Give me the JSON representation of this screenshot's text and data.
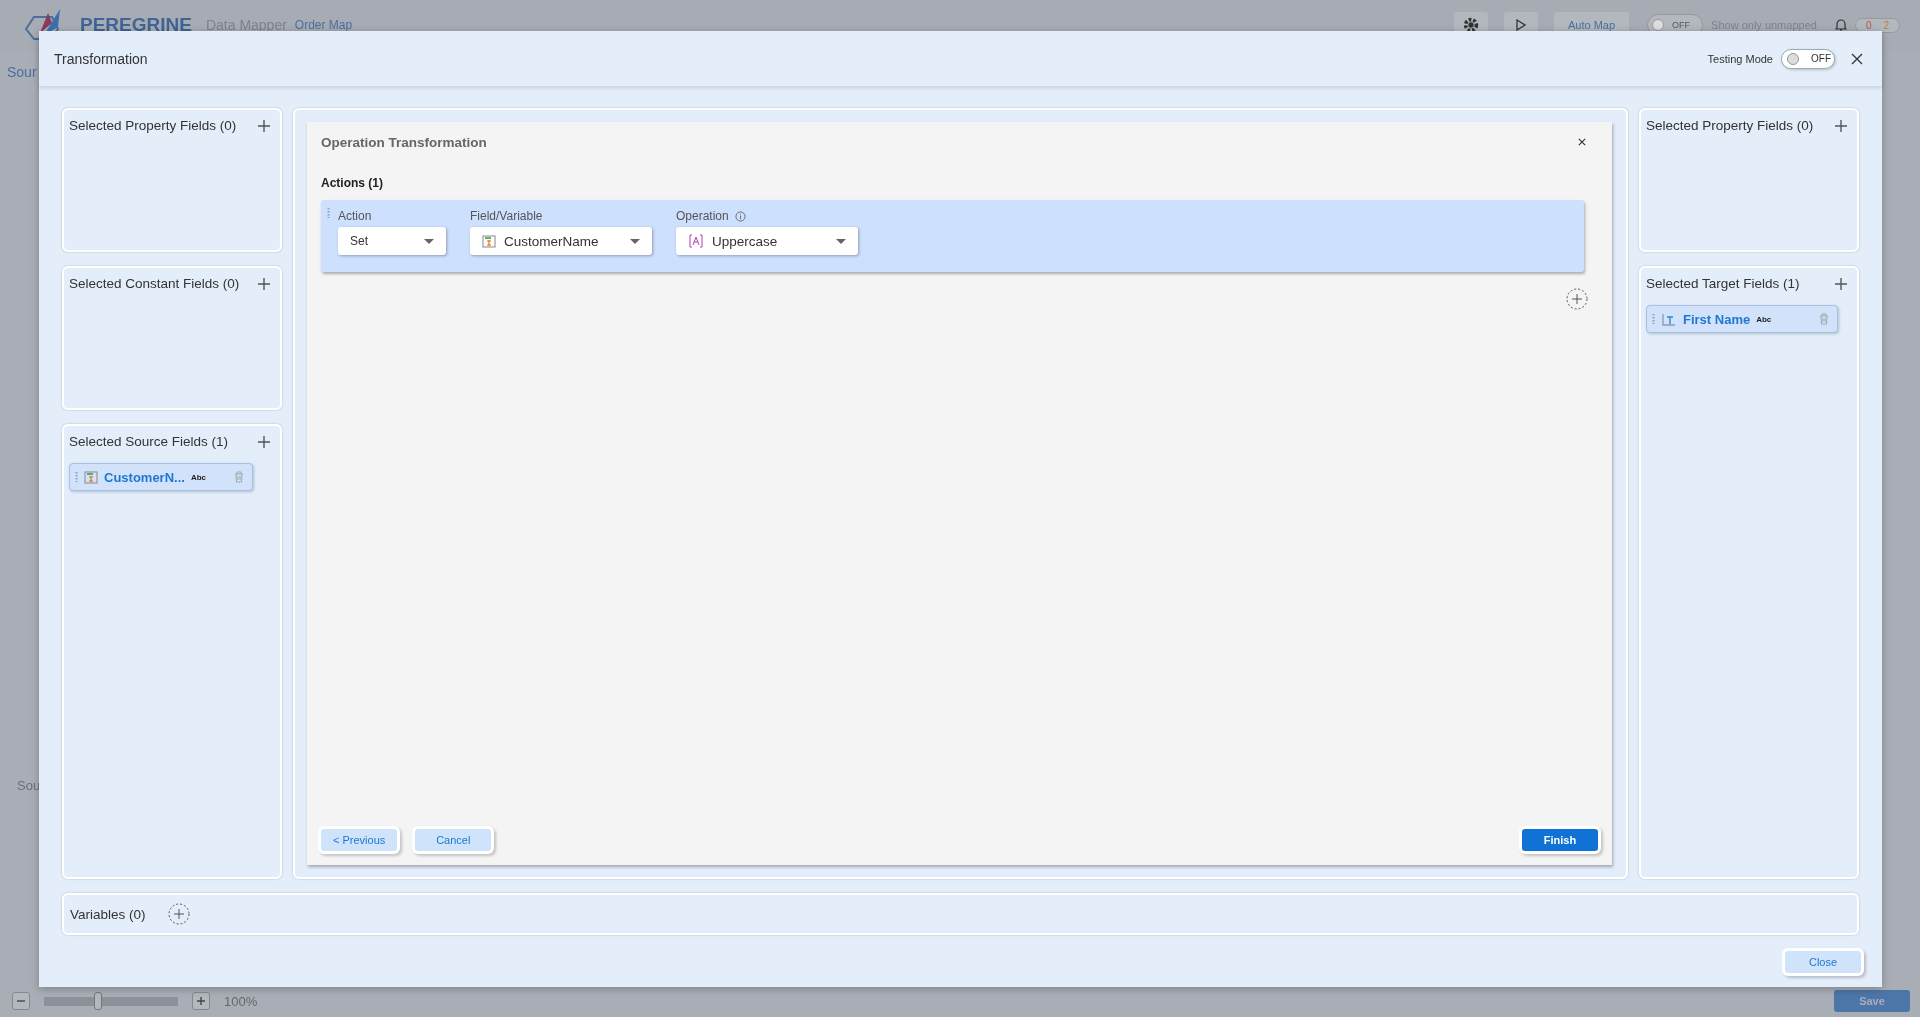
{
  "app": {
    "brand": "PEREGRINE",
    "subtitle": "Data Mapper",
    "map_name": "Order Map",
    "auto_map": "Auto Map",
    "unmapped_toggle": {
      "on": false,
      "text": "OFF",
      "label": "Show only unmapped"
    },
    "error_count": "0",
    "warning_count": "2",
    "source_tab": "Sour",
    "source_section": "Sou",
    "zoom": {
      "level": 0.4,
      "text": "100%"
    },
    "save": "Save"
  },
  "dialog": {
    "title": "Transformation",
    "testing_mode": {
      "label": "Testing Mode",
      "on": false,
      "text": "OFF"
    },
    "left_panels": [
      {
        "title": "Selected Property Fields (0)"
      },
      {
        "title": "Selected Constant Fields (0)"
      },
      {
        "title": "Selected Source Fields (1)",
        "fields": [
          {
            "name": "CustomerN...",
            "type": "Abc",
            "kind": "source"
          }
        ]
      }
    ],
    "right_panels": [
      {
        "title": "Selected Property Fields (0)"
      },
      {
        "title": "Selected Target Fields (1)",
        "fields": [
          {
            "name": "First Name",
            "type": "Abc",
            "kind": "target"
          }
        ]
      }
    ],
    "operation": {
      "title": "Operation Transformation",
      "actions_title": "Actions (1)",
      "actions": [
        {
          "columns": [
            {
              "label": "Action",
              "value": "Set",
              "kind": "plain",
              "info": false
            },
            {
              "label": "Field/Variable",
              "value": "CustomerName",
              "kind": "field",
              "info": false
            },
            {
              "label": "Operation",
              "value": "Uppercase",
              "kind": "operation",
              "info": true
            }
          ]
        }
      ],
      "buttons": [
        {
          "label": "< Previous",
          "kind": "secondary"
        },
        {
          "label": "Cancel",
          "kind": "secondary"
        },
        {
          "label": "Finish",
          "kind": "primary"
        }
      ]
    },
    "variables": {
      "title": "Variables (0)"
    },
    "close": "Close"
  }
}
